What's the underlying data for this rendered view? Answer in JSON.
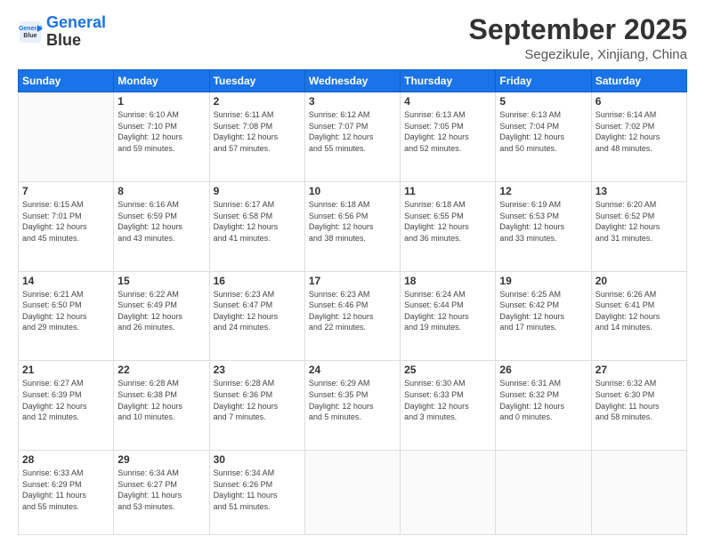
{
  "logo": {
    "line1": "General",
    "line2": "Blue"
  },
  "title": "September 2025",
  "subtitle": "Segezikule, Xinjiang, China",
  "days_of_week": [
    "Sunday",
    "Monday",
    "Tuesday",
    "Wednesday",
    "Thursday",
    "Friday",
    "Saturday"
  ],
  "weeks": [
    [
      {
        "day": "",
        "info": ""
      },
      {
        "day": "1",
        "info": "Sunrise: 6:10 AM\nSunset: 7:10 PM\nDaylight: 12 hours\nand 59 minutes."
      },
      {
        "day": "2",
        "info": "Sunrise: 6:11 AM\nSunset: 7:08 PM\nDaylight: 12 hours\nand 57 minutes."
      },
      {
        "day": "3",
        "info": "Sunrise: 6:12 AM\nSunset: 7:07 PM\nDaylight: 12 hours\nand 55 minutes."
      },
      {
        "day": "4",
        "info": "Sunrise: 6:13 AM\nSunset: 7:05 PM\nDaylight: 12 hours\nand 52 minutes."
      },
      {
        "day": "5",
        "info": "Sunrise: 6:13 AM\nSunset: 7:04 PM\nDaylight: 12 hours\nand 50 minutes."
      },
      {
        "day": "6",
        "info": "Sunrise: 6:14 AM\nSunset: 7:02 PM\nDaylight: 12 hours\nand 48 minutes."
      }
    ],
    [
      {
        "day": "7",
        "info": "Sunrise: 6:15 AM\nSunset: 7:01 PM\nDaylight: 12 hours\nand 45 minutes."
      },
      {
        "day": "8",
        "info": "Sunrise: 6:16 AM\nSunset: 6:59 PM\nDaylight: 12 hours\nand 43 minutes."
      },
      {
        "day": "9",
        "info": "Sunrise: 6:17 AM\nSunset: 6:58 PM\nDaylight: 12 hours\nand 41 minutes."
      },
      {
        "day": "10",
        "info": "Sunrise: 6:18 AM\nSunset: 6:56 PM\nDaylight: 12 hours\nand 38 minutes."
      },
      {
        "day": "11",
        "info": "Sunrise: 6:18 AM\nSunset: 6:55 PM\nDaylight: 12 hours\nand 36 minutes."
      },
      {
        "day": "12",
        "info": "Sunrise: 6:19 AM\nSunset: 6:53 PM\nDaylight: 12 hours\nand 33 minutes."
      },
      {
        "day": "13",
        "info": "Sunrise: 6:20 AM\nSunset: 6:52 PM\nDaylight: 12 hours\nand 31 minutes."
      }
    ],
    [
      {
        "day": "14",
        "info": "Sunrise: 6:21 AM\nSunset: 6:50 PM\nDaylight: 12 hours\nand 29 minutes."
      },
      {
        "day": "15",
        "info": "Sunrise: 6:22 AM\nSunset: 6:49 PM\nDaylight: 12 hours\nand 26 minutes."
      },
      {
        "day": "16",
        "info": "Sunrise: 6:23 AM\nSunset: 6:47 PM\nDaylight: 12 hours\nand 24 minutes."
      },
      {
        "day": "17",
        "info": "Sunrise: 6:23 AM\nSunset: 6:46 PM\nDaylight: 12 hours\nand 22 minutes."
      },
      {
        "day": "18",
        "info": "Sunrise: 6:24 AM\nSunset: 6:44 PM\nDaylight: 12 hours\nand 19 minutes."
      },
      {
        "day": "19",
        "info": "Sunrise: 6:25 AM\nSunset: 6:42 PM\nDaylight: 12 hours\nand 17 minutes."
      },
      {
        "day": "20",
        "info": "Sunrise: 6:26 AM\nSunset: 6:41 PM\nDaylight: 12 hours\nand 14 minutes."
      }
    ],
    [
      {
        "day": "21",
        "info": "Sunrise: 6:27 AM\nSunset: 6:39 PM\nDaylight: 12 hours\nand 12 minutes."
      },
      {
        "day": "22",
        "info": "Sunrise: 6:28 AM\nSunset: 6:38 PM\nDaylight: 12 hours\nand 10 minutes."
      },
      {
        "day": "23",
        "info": "Sunrise: 6:28 AM\nSunset: 6:36 PM\nDaylight: 12 hours\nand 7 minutes."
      },
      {
        "day": "24",
        "info": "Sunrise: 6:29 AM\nSunset: 6:35 PM\nDaylight: 12 hours\nand 5 minutes."
      },
      {
        "day": "25",
        "info": "Sunrise: 6:30 AM\nSunset: 6:33 PM\nDaylight: 12 hours\nand 3 minutes."
      },
      {
        "day": "26",
        "info": "Sunrise: 6:31 AM\nSunset: 6:32 PM\nDaylight: 12 hours\nand 0 minutes."
      },
      {
        "day": "27",
        "info": "Sunrise: 6:32 AM\nSunset: 6:30 PM\nDaylight: 11 hours\nand 58 minutes."
      }
    ],
    [
      {
        "day": "28",
        "info": "Sunrise: 6:33 AM\nSunset: 6:29 PM\nDaylight: 11 hours\nand 55 minutes."
      },
      {
        "day": "29",
        "info": "Sunrise: 6:34 AM\nSunset: 6:27 PM\nDaylight: 11 hours\nand 53 minutes."
      },
      {
        "day": "30",
        "info": "Sunrise: 6:34 AM\nSunset: 6:26 PM\nDaylight: 11 hours\nand 51 minutes."
      },
      {
        "day": "",
        "info": ""
      },
      {
        "day": "",
        "info": ""
      },
      {
        "day": "",
        "info": ""
      },
      {
        "day": "",
        "info": ""
      }
    ]
  ]
}
